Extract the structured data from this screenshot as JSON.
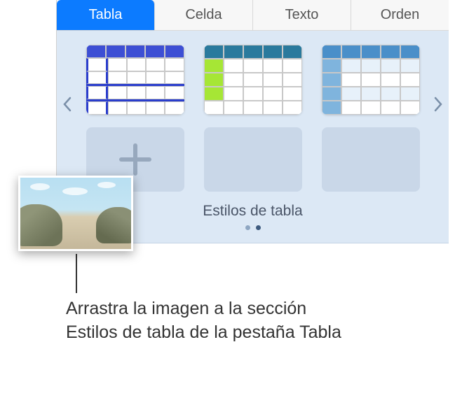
{
  "tabs": {
    "tabla": "Tabla",
    "celda": "Celda",
    "texto": "Texto",
    "orden": "Orden"
  },
  "styles": {
    "section_title": "Estilos de tabla"
  },
  "callout": {
    "text": "Arrastra la imagen a la sección Estilos de tabla de la pestaña Tabla"
  }
}
